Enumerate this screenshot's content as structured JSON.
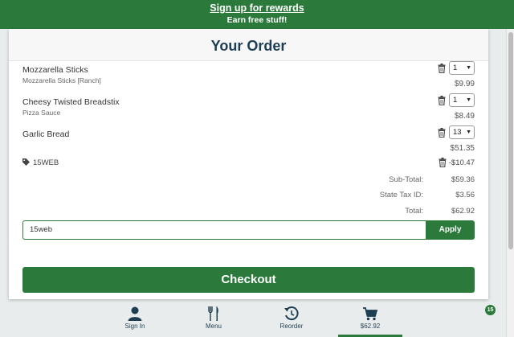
{
  "banner": {
    "title": "Sign up for rewards",
    "subtitle": "Earn free stuff!"
  },
  "order": {
    "heading": "Your Order",
    "items": [
      {
        "name": "Mozzarella Sticks",
        "detail": "Mozzarella Sticks [Ranch]",
        "qty": "1",
        "price": "$9.99"
      },
      {
        "name": "Cheesy Twisted Breadstix",
        "detail": "Pizza Sauce",
        "qty": "1",
        "price": "$8.49"
      },
      {
        "name": "Garlic Bread",
        "detail": "",
        "qty": "13",
        "price": "$51.35"
      }
    ],
    "coupon": {
      "code": "15WEB",
      "amount": "-$10.47"
    },
    "summary": {
      "subtotal_label": "Sub-Total:",
      "subtotal": "$59.36",
      "tax_label": "State Tax ID:",
      "tax": "$3.56",
      "total_label": "Total:",
      "total": "$62.92"
    },
    "promo": {
      "value": "15web",
      "apply_label": "Apply"
    },
    "checkout_label": "Checkout"
  },
  "nav": {
    "items": [
      {
        "label": "Sign In",
        "icon": "person-icon"
      },
      {
        "label": "Menu",
        "icon": "fork-knife-icon"
      },
      {
        "label": "Reorder",
        "icon": "reorder-icon"
      },
      {
        "label": "$62.92",
        "icon": "cart-icon"
      }
    ],
    "cart_count": "15"
  },
  "colors": {
    "brand_green": "#2b7a3b",
    "heading_navy": "#1d3d52"
  }
}
